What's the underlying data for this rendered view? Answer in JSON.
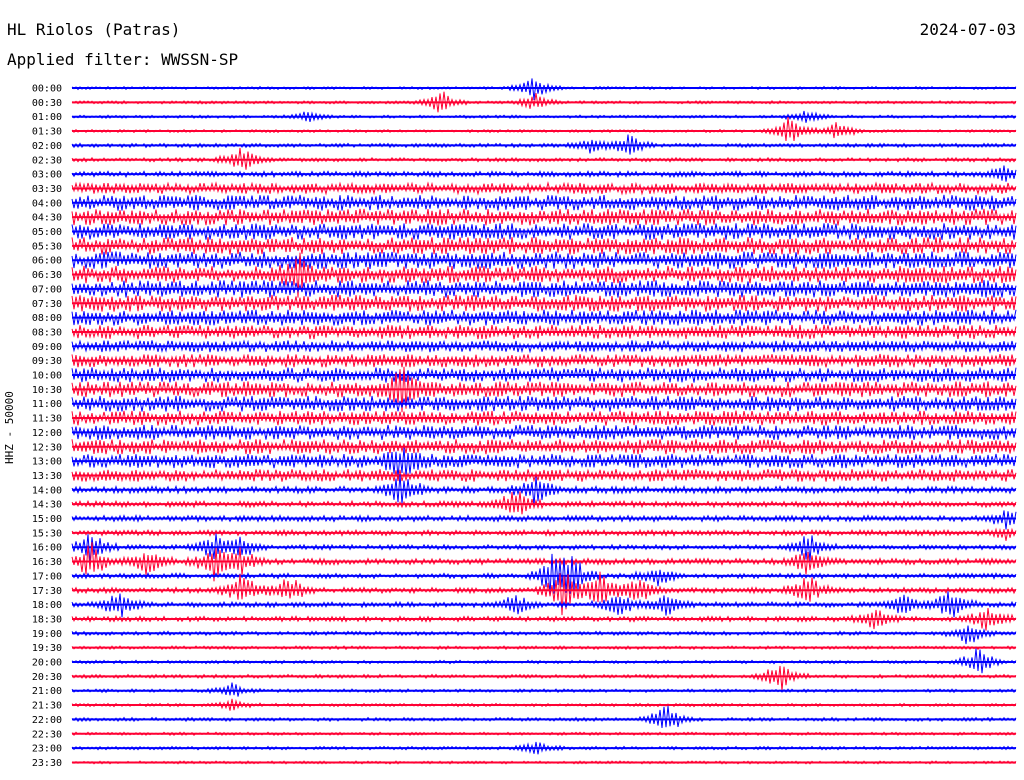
{
  "header": {
    "station": "HL Riolos (Patras)",
    "filter": "Applied filter: WWSSN-SP",
    "date": "2024-07-03"
  },
  "chart_data": {
    "type": "line",
    "subtype": "helicorder",
    "ylabel": "HHZ - 50000",
    "trace_colors": [
      "#0000ff",
      "#ff0033"
    ],
    "rows": [
      {
        "time": "00:00",
        "activity": 0.05,
        "events": [
          {
            "x": 0.49,
            "amp": 4
          },
          {
            "x": 0.49,
            "amp": 5
          }
        ]
      },
      {
        "time": "00:30",
        "activity": 0.06,
        "events": [
          {
            "x": 0.39,
            "amp": 10
          },
          {
            "x": 0.49,
            "amp": 7
          }
        ]
      },
      {
        "time": "01:00",
        "activity": 0.06,
        "events": [
          {
            "x": 0.25,
            "amp": 4
          },
          {
            "x": 0.78,
            "amp": 5
          }
        ]
      },
      {
        "time": "01:30",
        "activity": 0.05,
        "events": [
          {
            "x": 0.76,
            "amp": 10
          },
          {
            "x": 0.81,
            "amp": 8
          }
        ]
      },
      {
        "time": "02:00",
        "activity": 0.12,
        "events": [
          {
            "x": 0.55,
            "amp": 5
          },
          {
            "x": 0.59,
            "amp": 7
          }
        ]
      },
      {
        "time": "02:30",
        "activity": 0.12,
        "events": [
          {
            "x": 0.18,
            "amp": 9
          }
        ]
      },
      {
        "time": "03:00",
        "activity": 0.22,
        "events": [
          {
            "x": 0.99,
            "amp": 6
          }
        ]
      },
      {
        "time": "03:30",
        "activity": 0.55,
        "events": []
      },
      {
        "time": "04:00",
        "activity": 0.85,
        "events": []
      },
      {
        "time": "04:30",
        "activity": 0.9,
        "events": []
      },
      {
        "time": "05:00",
        "activity": 0.9,
        "events": []
      },
      {
        "time": "05:30",
        "activity": 0.95,
        "events": []
      },
      {
        "time": "06:00",
        "activity": 0.95,
        "events": []
      },
      {
        "time": "06:30",
        "activity": 0.95,
        "events": [
          {
            "x": 0.24,
            "amp": 12
          }
        ]
      },
      {
        "time": "07:00",
        "activity": 0.95,
        "events": []
      },
      {
        "time": "07:30",
        "activity": 0.9,
        "events": []
      },
      {
        "time": "08:00",
        "activity": 0.85,
        "events": []
      },
      {
        "time": "08:30",
        "activity": 0.75,
        "events": []
      },
      {
        "time": "09:00",
        "activity": 0.6,
        "events": []
      },
      {
        "time": "09:30",
        "activity": 0.7,
        "events": []
      },
      {
        "time": "10:00",
        "activity": 0.8,
        "events": []
      },
      {
        "time": "10:30",
        "activity": 0.85,
        "events": [
          {
            "x": 0.35,
            "amp": 14
          }
        ]
      },
      {
        "time": "11:00",
        "activity": 0.85,
        "events": []
      },
      {
        "time": "11:30",
        "activity": 0.8,
        "events": []
      },
      {
        "time": "12:00",
        "activity": 0.8,
        "events": []
      },
      {
        "time": "12:30",
        "activity": 0.8,
        "events": []
      },
      {
        "time": "13:00",
        "activity": 0.75,
        "events": [
          {
            "x": 0.35,
            "amp": 12
          }
        ]
      },
      {
        "time": "13:30",
        "activity": 0.65,
        "events": []
      },
      {
        "time": "14:00",
        "activity": 0.3,
        "events": [
          {
            "x": 0.35,
            "amp": 12
          },
          {
            "x": 0.49,
            "amp": 10
          }
        ]
      },
      {
        "time": "14:30",
        "activity": 0.25,
        "events": [
          {
            "x": 0.47,
            "amp": 12
          }
        ]
      },
      {
        "time": "15:00",
        "activity": 0.25,
        "events": [
          {
            "x": 0.99,
            "amp": 6
          }
        ]
      },
      {
        "time": "15:30",
        "activity": 0.22,
        "events": [
          {
            "x": 0.99,
            "amp": 5
          }
        ]
      },
      {
        "time": "16:00",
        "activity": 0.18,
        "events": [
          {
            "x": 0.02,
            "amp": 12
          },
          {
            "x": 0.15,
            "amp": 10
          },
          {
            "x": 0.18,
            "amp": 8
          },
          {
            "x": 0.78,
            "amp": 10
          }
        ]
      },
      {
        "time": "16:30",
        "activity": 0.25,
        "events": [
          {
            "x": 0.02,
            "amp": 14
          },
          {
            "x": 0.08,
            "amp": 10
          },
          {
            "x": 0.15,
            "amp": 12
          },
          {
            "x": 0.18,
            "amp": 10
          },
          {
            "x": 0.78,
            "amp": 12
          }
        ]
      },
      {
        "time": "17:00",
        "activity": 0.2,
        "events": [
          {
            "x": 0.51,
            "amp": 16
          },
          {
            "x": 0.53,
            "amp": 14
          },
          {
            "x": 0.62,
            "amp": 8
          }
        ]
      },
      {
        "time": "17:30",
        "activity": 0.22,
        "events": [
          {
            "x": 0.18,
            "amp": 12
          },
          {
            "x": 0.23,
            "amp": 10
          },
          {
            "x": 0.52,
            "amp": 18
          },
          {
            "x": 0.56,
            "amp": 14
          },
          {
            "x": 0.6,
            "amp": 10
          },
          {
            "x": 0.78,
            "amp": 10
          }
        ]
      },
      {
        "time": "18:00",
        "activity": 0.2,
        "events": [
          {
            "x": 0.05,
            "amp": 10
          },
          {
            "x": 0.47,
            "amp": 8
          },
          {
            "x": 0.58,
            "amp": 10
          },
          {
            "x": 0.63,
            "amp": 8
          },
          {
            "x": 0.88,
            "amp": 8
          },
          {
            "x": 0.93,
            "amp": 12
          }
        ]
      },
      {
        "time": "18:30",
        "activity": 0.2,
        "events": [
          {
            "x": 0.85,
            "amp": 8
          },
          {
            "x": 0.97,
            "amp": 10
          }
        ]
      },
      {
        "time": "19:00",
        "activity": 0.12,
        "events": [
          {
            "x": 0.95,
            "amp": 8
          }
        ]
      },
      {
        "time": "19:30",
        "activity": 0.08,
        "events": []
      },
      {
        "time": "20:00",
        "activity": 0.08,
        "events": [
          {
            "x": 0.96,
            "amp": 12
          }
        ]
      },
      {
        "time": "20:30",
        "activity": 0.1,
        "events": [
          {
            "x": 0.75,
            "amp": 12
          }
        ]
      },
      {
        "time": "21:00",
        "activity": 0.08,
        "events": [
          {
            "x": 0.17,
            "amp": 5
          }
        ]
      },
      {
        "time": "21:30",
        "activity": 0.07,
        "events": [
          {
            "x": 0.17,
            "amp": 4
          }
        ]
      },
      {
        "time": "22:00",
        "activity": 0.1,
        "events": [
          {
            "x": 0.63,
            "amp": 12
          }
        ]
      },
      {
        "time": "22:30",
        "activity": 0.06,
        "events": []
      },
      {
        "time": "23:00",
        "activity": 0.08,
        "events": [
          {
            "x": 0.49,
            "amp": 5
          }
        ]
      },
      {
        "time": "23:30",
        "activity": 0.05,
        "events": []
      }
    ]
  }
}
